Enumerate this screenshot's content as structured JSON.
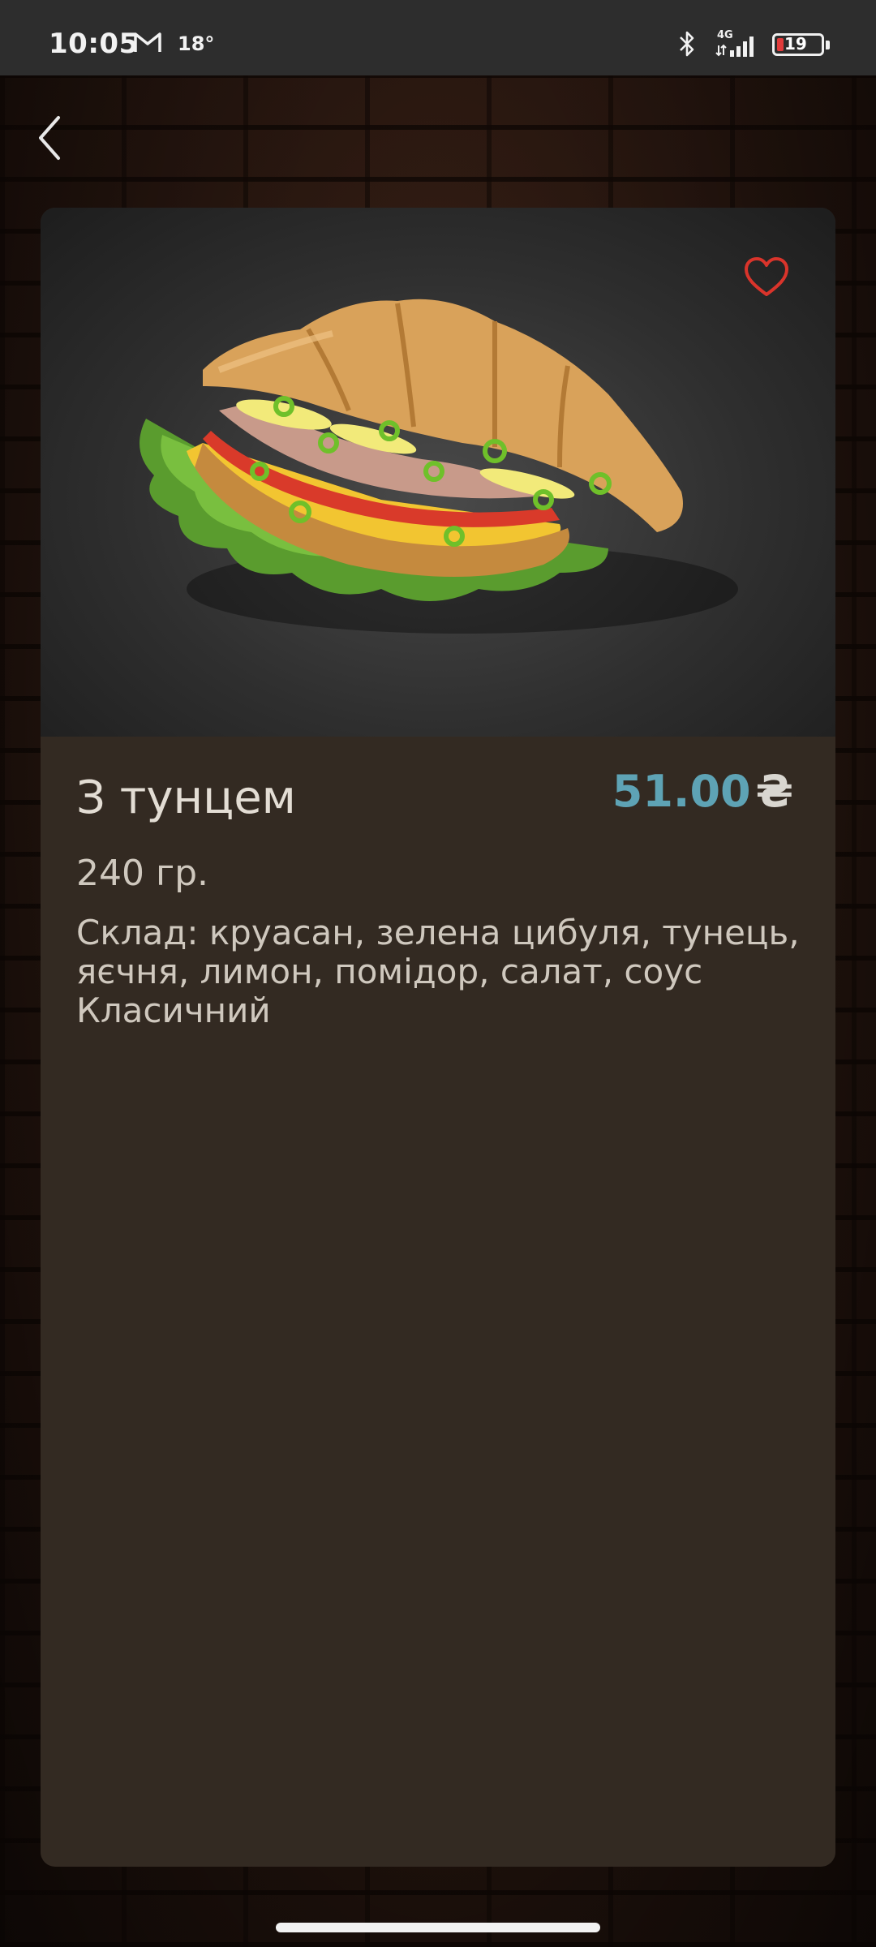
{
  "status_bar": {
    "time": "10:05",
    "temperature": "18°",
    "network": "4G",
    "battery": "19"
  },
  "product": {
    "title": "З тунцем",
    "price": "51.00",
    "currency": "₴",
    "weight": "240 гр.",
    "description": "Склад: круасан, зелена цибуля, тунець, яєчня, лимон, помідор, салат, соус Класичний"
  },
  "colors": {
    "price_accent": "#5ea3b5",
    "favorite_icon": "#d9342b",
    "card_background": "#332a22"
  }
}
